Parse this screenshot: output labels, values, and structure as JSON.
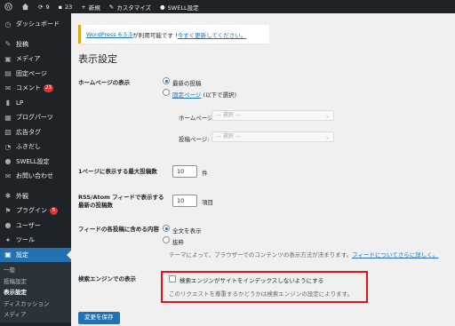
{
  "adminbar": {
    "updates_count": "9",
    "comments_count": "23",
    "new_label": "新規",
    "customize_label": "カスタマイズ",
    "swell_label": "SWELL設定"
  },
  "sidebar": {
    "items": [
      {
        "label": "ダッシュボード",
        "icon": "dashboard-icon",
        "glyph": "◷"
      },
      {
        "label": "投稿",
        "icon": "pin-icon",
        "glyph": "✎"
      },
      {
        "label": "メディア",
        "icon": "media-icon",
        "glyph": "▣"
      },
      {
        "label": "固定ページ",
        "icon": "page-icon",
        "glyph": "▤"
      },
      {
        "label": "コメント",
        "icon": "comment-icon",
        "glyph": "✉",
        "badge": "23"
      },
      {
        "label": "LP",
        "icon": "lp-icon",
        "glyph": "▮"
      },
      {
        "label": "ブログパーツ",
        "icon": "blog-parts-icon",
        "glyph": "▦"
      },
      {
        "label": "広告タグ",
        "icon": "ad-tag-icon",
        "glyph": "▧"
      },
      {
        "label": "ふきだし",
        "icon": "balloon-icon",
        "glyph": "◔"
      },
      {
        "label": "SWELL設定",
        "icon": "swell-icon",
        "glyph": "●"
      },
      {
        "label": "お問い合わせ",
        "icon": "contact-icon",
        "glyph": "✉"
      },
      {
        "label": "外観",
        "icon": "appearance-icon",
        "glyph": "✱"
      },
      {
        "label": "プラグイン",
        "icon": "plugin-icon",
        "glyph": "⚑",
        "badge": "5"
      },
      {
        "label": "ユーザー",
        "icon": "user-icon",
        "glyph": "●"
      },
      {
        "label": "ツール",
        "icon": "tool-icon",
        "glyph": "✦"
      },
      {
        "label": "設定",
        "icon": "settings-icon",
        "glyph": "▣"
      }
    ],
    "submenu": [
      "一般",
      "投稿設定",
      "表示設定",
      "ディスカッション",
      "メディア"
    ]
  },
  "notice": {
    "link1": "WordPress 6.5.5",
    "middle": " が利用可能です ! ",
    "link2": "今すぐ更新してください。"
  },
  "page": {
    "title": "表示設定",
    "homepage_label": "ホームページの表示",
    "latest_posts": "最新の投稿",
    "static_page_link": "固定ページ",
    "static_page_rest": " (以下で選択)",
    "homepage_select_label": "ホームページ:",
    "posts_select_label": "投稿ページ:",
    "select_placeholder": "— 選択 —",
    "posts_per_page_label": "1ページに表示する最大投稿数",
    "posts_per_page_value": "10",
    "posts_unit": "件",
    "rss_label": "RSS/Atom フィードで表示する最新の投稿数",
    "rss_value": "10",
    "rss_unit": "項目",
    "feed_label": "フィードの各投稿に含める内容",
    "full_text": "全文を表示",
    "excerpt": "抜粋",
    "theme_note_prefix": "テーマによって、ブラウザーでのコンテンツの表示方法が決まります。",
    "theme_note_link": "フィードについてさらに詳しく。",
    "search_label": "検索エンジンでの表示",
    "search_checkbox": "検索エンジンがサイトをインデックスしないようにする",
    "search_note": "このリクエストを尊重するかどうかは検索エンジンの設定によります。",
    "save_button": "変更を保存"
  },
  "colors": {
    "admin_bg": "#1d2327",
    "accent": "#2271b1",
    "badge": "#d63638",
    "highlight": "#e1141b"
  }
}
